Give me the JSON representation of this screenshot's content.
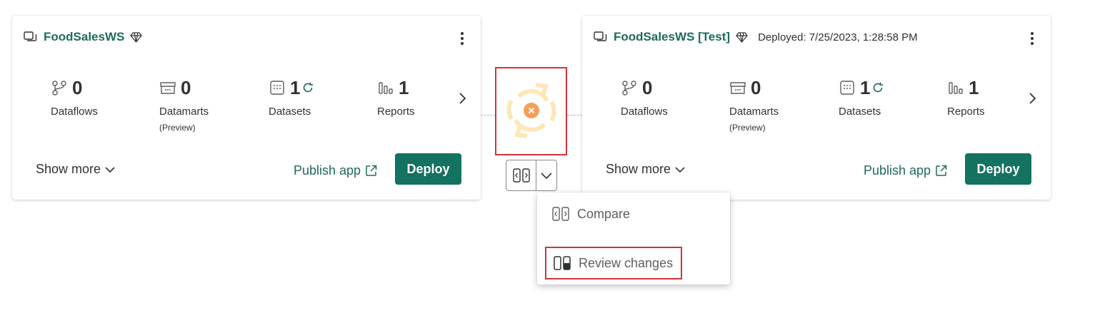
{
  "cards": [
    {
      "title": "FoodSalesWS",
      "deployed": "",
      "stats": [
        {
          "count": "0",
          "label": "Dataflows",
          "sub": ""
        },
        {
          "count": "0",
          "label": "Datamarts",
          "sub": "(Preview)"
        },
        {
          "count": "1",
          "label": "Datasets",
          "sub": ""
        },
        {
          "count": "1",
          "label": "Reports",
          "sub": ""
        }
      ],
      "show_more": "Show more",
      "publish_app": "Publish app",
      "deploy": "Deploy"
    },
    {
      "title": "FoodSalesWS [Test]",
      "deployed": "Deployed: 7/25/2023, 1:28:58 PM",
      "stats": [
        {
          "count": "0",
          "label": "Dataflows",
          "sub": ""
        },
        {
          "count": "0",
          "label": "Datamarts",
          "sub": "(Preview)"
        },
        {
          "count": "1",
          "label": "Datasets",
          "sub": ""
        },
        {
          "count": "1",
          "label": "Reports",
          "sub": ""
        }
      ],
      "show_more": "Show more",
      "publish_app": "Publish app",
      "deploy": "Deploy"
    }
  ],
  "menu": {
    "compare": "Compare",
    "review_changes": "Review changes"
  },
  "colors": {
    "brand": "#137260",
    "link": "#1e6b5a",
    "highlight": "#d13438",
    "status_ring": "#fde7b6",
    "status_badge": "#f4a05a"
  },
  "icons": {
    "workspace": "workspace-icon",
    "premium": "diamond-icon",
    "dataflows": "dataflow-icon",
    "datamarts": "datamart-icon",
    "datasets": "dataset-icon",
    "reports": "report-icon",
    "refresh": "refresh-icon",
    "external": "external-link-icon",
    "status": "sync-error-icon"
  }
}
